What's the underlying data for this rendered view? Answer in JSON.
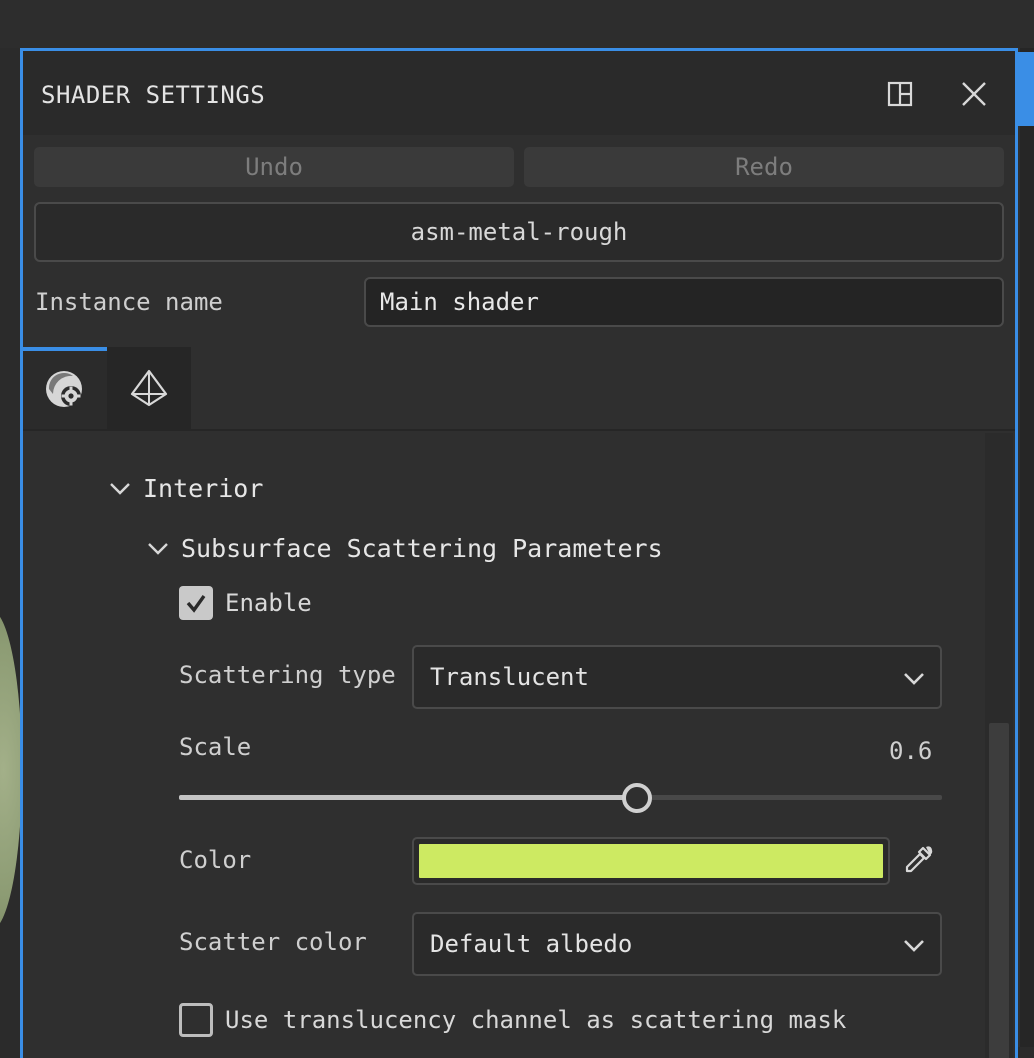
{
  "window": {
    "title": "SHADER SETTINGS",
    "layout_icon": "dock-layout-icon",
    "close_icon": "close-icon"
  },
  "toolbar": {
    "undo_label": "Undo",
    "redo_label": "Redo"
  },
  "shader": {
    "name": "asm-metal-rough"
  },
  "instance": {
    "label": "Instance name",
    "value": "Main shader"
  },
  "tabs": [
    {
      "icon": "shader-settings-icon",
      "active": true
    },
    {
      "icon": "geometry-icon",
      "active": false
    }
  ],
  "sections": {
    "interior": {
      "label": "Interior",
      "expanded": true
    },
    "sss": {
      "label": "Subsurface Scattering Parameters",
      "expanded": true,
      "enable_label": "Enable",
      "enable_checked": true,
      "scattering_type_label": "Scattering type",
      "scattering_type_value": "Translucent",
      "scale_label": "Scale",
      "scale_value": "0.6",
      "scale_fraction": 0.6,
      "color_label": "Color",
      "color_value": "#cdea62",
      "scatter_color_label": "Scatter color",
      "scatter_color_value": "Default albedo",
      "mask_label": "Use translucency channel as scattering mask",
      "mask_checked": false
    }
  },
  "colors": {
    "accent": "#3a8ee6",
    "panel_bg": "#2f2f2f"
  }
}
